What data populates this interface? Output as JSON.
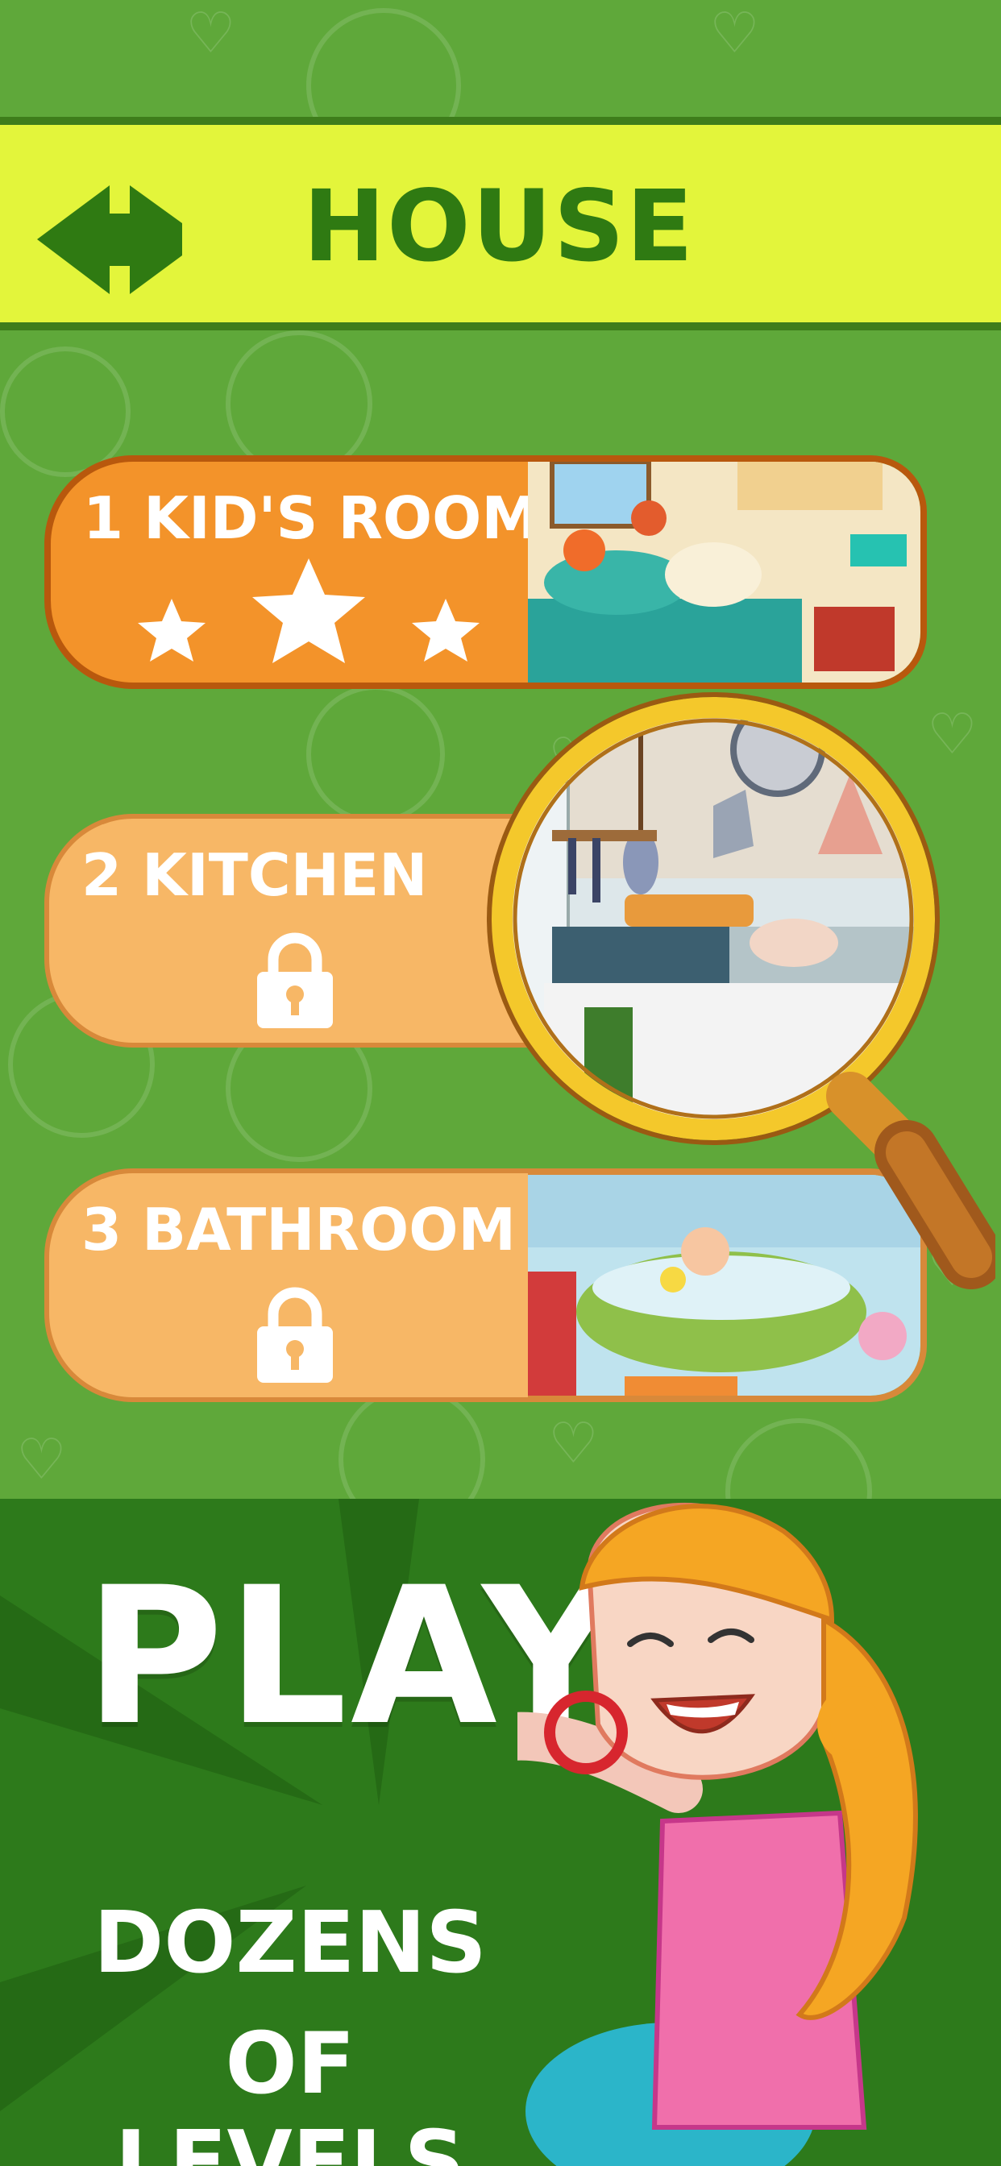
{
  "header": {
    "title": "HOUSE",
    "back_icon": "back-arrow-icon"
  },
  "levels": [
    {
      "label": "1 KID'S ROOM",
      "state": "unlocked",
      "stars": 3
    },
    {
      "label": "2   KITCHEN",
      "state": "locked"
    },
    {
      "label": "3 BATHROOM",
      "state": "locked"
    }
  ],
  "promo": {
    "headline": "PLAY",
    "line1": "DOZENS",
    "line2": "OF LEVELS"
  },
  "colors": {
    "background": "#5fa83a",
    "header": "#e3f53b",
    "title": "#2f7a12",
    "active_level": "#f3932a",
    "locked_level": "#f7b766"
  }
}
